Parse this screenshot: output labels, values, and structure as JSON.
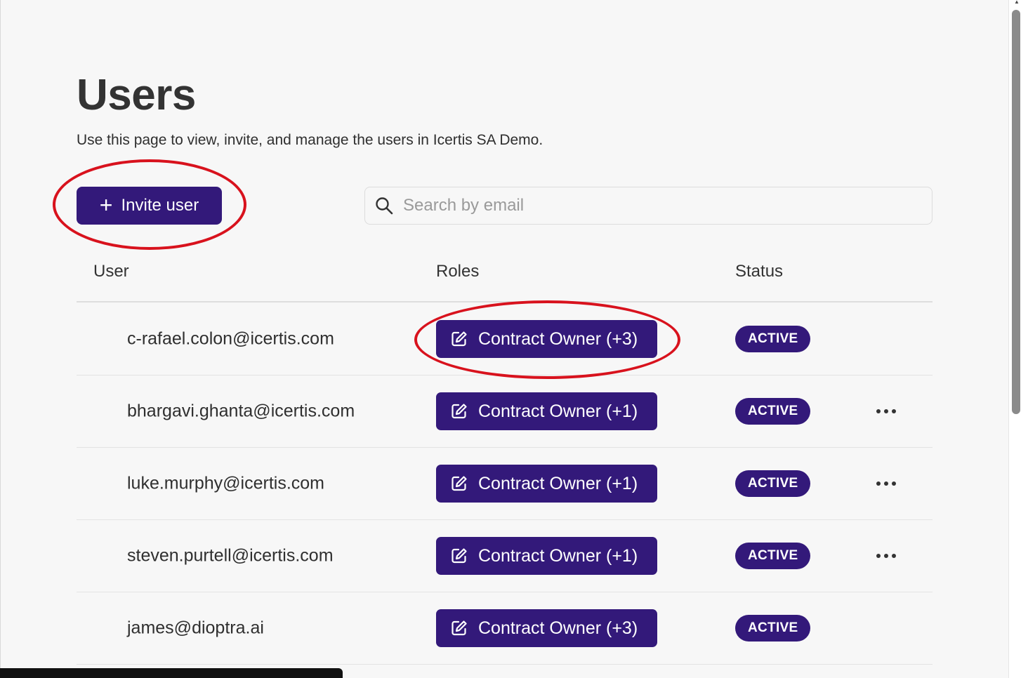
{
  "page": {
    "title": "Users",
    "subtitle": "Use this page to view, invite, and manage the users in Icertis SA Demo."
  },
  "toolbar": {
    "invite_label": "Invite user",
    "invite_icon": "plus-icon",
    "search_placeholder": "Search by email",
    "search_value": "",
    "search_icon": "search-icon"
  },
  "table": {
    "columns": [
      "User",
      "Roles",
      "Status"
    ],
    "rows": [
      {
        "email": "c-rafael.colon@icertis.com",
        "role": "Contract Owner (+3)",
        "status": "ACTIVE",
        "has_menu": false
      },
      {
        "email": "bhargavi.ghanta@icertis.com",
        "role": "Contract Owner (+1)",
        "status": "ACTIVE",
        "has_menu": true
      },
      {
        "email": "luke.murphy@icertis.com",
        "role": "Contract Owner (+1)",
        "status": "ACTIVE",
        "has_menu": true
      },
      {
        "email": "steven.purtell@icertis.com",
        "role": "Contract Owner (+1)",
        "status": "ACTIVE",
        "has_menu": true
      },
      {
        "email": "james@dioptra.ai",
        "role": "Contract Owner (+3)",
        "status": "ACTIVE",
        "has_menu": false
      }
    ]
  },
  "colors": {
    "accent": "#33197a",
    "annotation": "#d8121d",
    "background": "#f7f7f7"
  }
}
